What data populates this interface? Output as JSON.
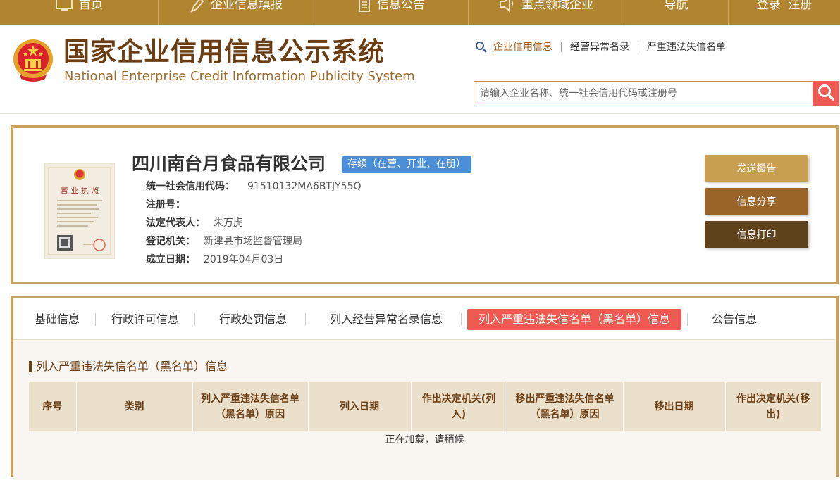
{
  "nav": {
    "items": [
      {
        "label": "首页",
        "icon": "monitor-icon"
      },
      {
        "label": "企业信息填报",
        "icon": "pen-icon"
      },
      {
        "label": "信息公告",
        "icon": "document-icon"
      },
      {
        "label": "重点领域企业",
        "icon": "speaker-icon"
      },
      {
        "label": "导航",
        "icon": ""
      },
      {
        "label": "登录  注册",
        "icon": ""
      }
    ]
  },
  "header": {
    "title_cn": "国家企业信用信息公示系统",
    "title_en": "National Enterprise Credit Information Publicity System",
    "search_tabs": [
      "企业信用信息",
      "经营异常名录",
      "严重违法失信名单"
    ],
    "search_placeholder": "请输入企业名称、统一社会信用代码或注册号"
  },
  "company": {
    "name": "四川南台月食品有限公司",
    "status": "存续（在营、开业、在册）",
    "license_title": "营 业 执 照",
    "fields": [
      {
        "label": "统一社会信用代码：",
        "value": "91510132MA6BTJY55Q"
      },
      {
        "label": "注册号：",
        "value": ""
      },
      {
        "label": "法定代表人：",
        "value": "朱万虎"
      },
      {
        "label": "登记机关：",
        "value": "新津县市场监督管理局"
      },
      {
        "label": "成立日期：",
        "value": "2019年04月03日"
      }
    ],
    "buttons": [
      {
        "label": "发送报告",
        "color": "#c9a052"
      },
      {
        "label": "信息分享",
        "color": "#9a6428"
      },
      {
        "label": "信息打印",
        "color": "#5e421c"
      }
    ]
  },
  "tabs": {
    "items": [
      "基础信息",
      "行政许可信息",
      "行政处罚信息",
      "列入经营异常名录信息",
      "列入严重违法失信名单（黑名单）信息",
      "公告信息"
    ],
    "active_index": 4
  },
  "content": {
    "title": "列入严重违法失信名单（黑名单）信息",
    "columns": [
      "序号",
      "类别",
      "列入严重违法失信名单（黑名单）原因",
      "列入日期",
      "作出决定机关(列入)",
      "移出严重违法失信名单（黑名单）原因",
      "移出日期",
      "作出决定机关(移出)"
    ],
    "loading_text": "正在加载，请稍候"
  },
  "colors": {
    "nav_bg": "#b1852f",
    "accent_red": "#ee5a52",
    "status_blue": "#4a8fd8",
    "border_gold": "#c8a15a",
    "title_brown": "#6a3d13"
  }
}
